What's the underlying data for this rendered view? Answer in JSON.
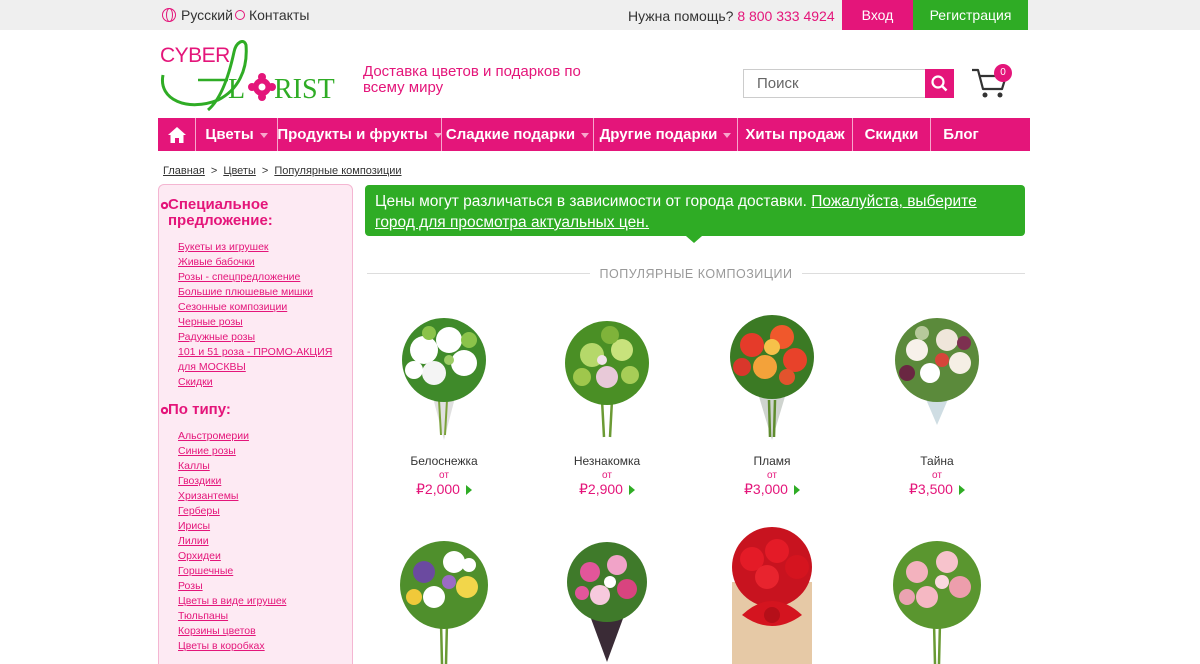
{
  "topbar": {
    "language": "Русский",
    "contacts": "Контакты",
    "help_label": "Нужна помощь?",
    "phone": "8 800 333 4924",
    "login": "Вход",
    "register": "Регистрация"
  },
  "header": {
    "logo_top": "CYBER",
    "logo_bottom": "FLORIST",
    "tagline": "Доставка цветов и подарков по всему миру",
    "search_placeholder": "Поиск",
    "cart_count": "0"
  },
  "nav": {
    "items": [
      {
        "label": "Цветы",
        "dropdown": true
      },
      {
        "label": "Продукты и фрукты",
        "dropdown": true
      },
      {
        "label": "Сладкие подарки",
        "dropdown": true
      },
      {
        "label": "Другие подарки",
        "dropdown": true
      },
      {
        "label": "Хиты продаж",
        "dropdown": false
      },
      {
        "label": "Скидки",
        "dropdown": false
      },
      {
        "label": "Блог",
        "dropdown": false
      }
    ]
  },
  "breadcrumb": {
    "items": [
      "Главная",
      "Цветы",
      "Популярные композиции"
    ]
  },
  "sidebar": {
    "special_title": "Специальное предложение:",
    "special_items": [
      "Букеты из игрушек",
      "Живые бабочки",
      "Розы - спецпредложение",
      "Большие плюшевые мишки",
      "Сезонные композиции",
      "Черные розы",
      "Радужные розы",
      "101 и 51 роза - ПРОМО-АКЦИЯ для МОСКВЫ",
      "Скидки"
    ],
    "type_title": "По типу:",
    "type_items": [
      "Альстромерии",
      "Синие розы",
      "Каллы",
      "Гвоздики",
      "Хризантемы",
      "Герберы",
      "Ирисы",
      "Лилии",
      "Орхидеи",
      "Горшечные",
      "Розы",
      "Цветы в виде игрушек",
      "Тюльпаны",
      "Корзины цветов",
      "Цветы в коробках"
    ]
  },
  "notice": {
    "text": "Цены могут различаться в зависимости от города доставки. ",
    "link": "Пожалуйста, выберите город для просмотра актуальных цен."
  },
  "section_title": "ПОПУЛЯРНЫЕ КОМПОЗИЦИИ",
  "products": [
    {
      "name": "Белоснежка",
      "from": "от",
      "price": "₽2,000"
    },
    {
      "name": "Незнакомка",
      "from": "от",
      "price": "₽2,900"
    },
    {
      "name": "Пламя",
      "from": "от",
      "price": "₽3,000"
    },
    {
      "name": "Тайна",
      "from": "от",
      "price": "₽3,500"
    }
  ],
  "colors": {
    "brand_pink": "#e4157a",
    "brand_green": "#2fac25",
    "sidebar_bg": "#fdeaf3"
  }
}
